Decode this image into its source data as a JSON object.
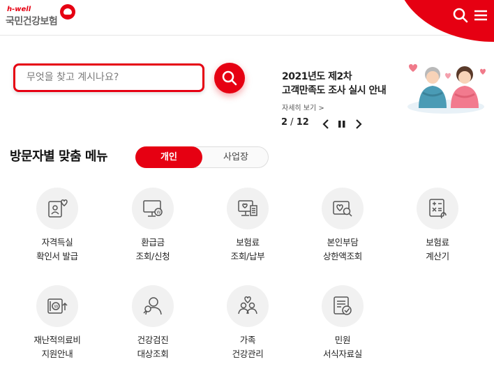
{
  "header": {
    "logo_small": "h-well",
    "logo_main": "국민건강보험",
    "search_icon": "search-icon",
    "menu_icon": "hamburger-menu-icon"
  },
  "search": {
    "placeholder": "무엇을 찾고 계시나요?"
  },
  "banner": {
    "title_line1": "2021년도 제2차",
    "title_line2": "고객만족도 조사 실시 안내",
    "link": "자세히 보기 >",
    "current": "2",
    "separator": " / ",
    "total": "12"
  },
  "section": {
    "title": "방문자별 맞춤 메뉴",
    "tabs": [
      "개인",
      "사업장"
    ]
  },
  "menu": [
    {
      "line1": "자격득실",
      "line2": "확인서 발급",
      "icon": "id-card-heart-icon"
    },
    {
      "line1": "환급금",
      "line2": "조회/신청",
      "icon": "monitor-won-icon"
    },
    {
      "line1": "보험료",
      "line2": "조회/납부",
      "icon": "computer-receipt-icon"
    },
    {
      "line1": "본인부담",
      "line2": "상한액조회",
      "icon": "heart-search-icon"
    },
    {
      "line1": "보험료",
      "line2": "계산기",
      "icon": "calculator-icon"
    },
    {
      "line1": "재난적의료비",
      "line2": "지원안내",
      "icon": "wallet-won-icon"
    },
    {
      "line1": "건강검진",
      "line2": "대상조회",
      "icon": "person-search-icon"
    },
    {
      "line1": "가족",
      "line2": "건강관리",
      "icon": "family-heart-icon"
    },
    {
      "line1": "민원",
      "line2": "서식자료실",
      "icon": "document-check-icon"
    }
  ],
  "colors": {
    "accent": "#e60012"
  }
}
